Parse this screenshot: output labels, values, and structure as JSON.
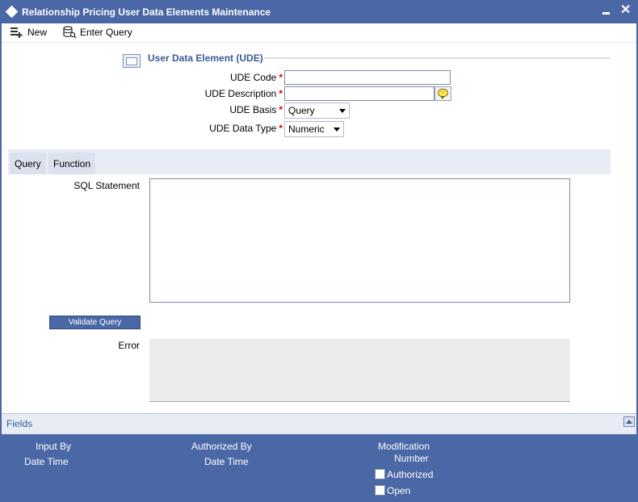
{
  "window": {
    "title": "Relationship Pricing User Data Elements Maintenance",
    "minimize_icon": "minimize-icon",
    "close_icon": "close-icon"
  },
  "toolbar": {
    "new_label": "New",
    "enter_query_label": "Enter Query"
  },
  "section": {
    "title": "User Data Element (UDE)"
  },
  "form": {
    "ude_code_label": "UDE Code",
    "ude_code_value": "",
    "ude_description_label": "UDE Description",
    "ude_description_value": "",
    "ude_basis_label": "UDE Basis",
    "ude_basis_value": "Query",
    "ude_data_type_label": "UDE Data Type",
    "ude_data_type_value": "Numeric",
    "required_marker": "*"
  },
  "tabs": [
    {
      "label": "Query"
    },
    {
      "label": "Function"
    }
  ],
  "query": {
    "sql_statement_label": "SQL Statement",
    "sql_statement_value": "",
    "validate_button_label": "Validate Query",
    "error_label": "Error"
  },
  "fields_bar": {
    "label": "Fields"
  },
  "footer": {
    "input_by_label": "Input By",
    "input_date_time_label": "Date Time",
    "authorized_by_label": "Authorized By",
    "authorized_date_time_label": "Date Time",
    "modification_label": "Modification",
    "number_label": "Number",
    "authorized_checkbox_label": "Authorized",
    "open_checkbox_label": "Open"
  }
}
